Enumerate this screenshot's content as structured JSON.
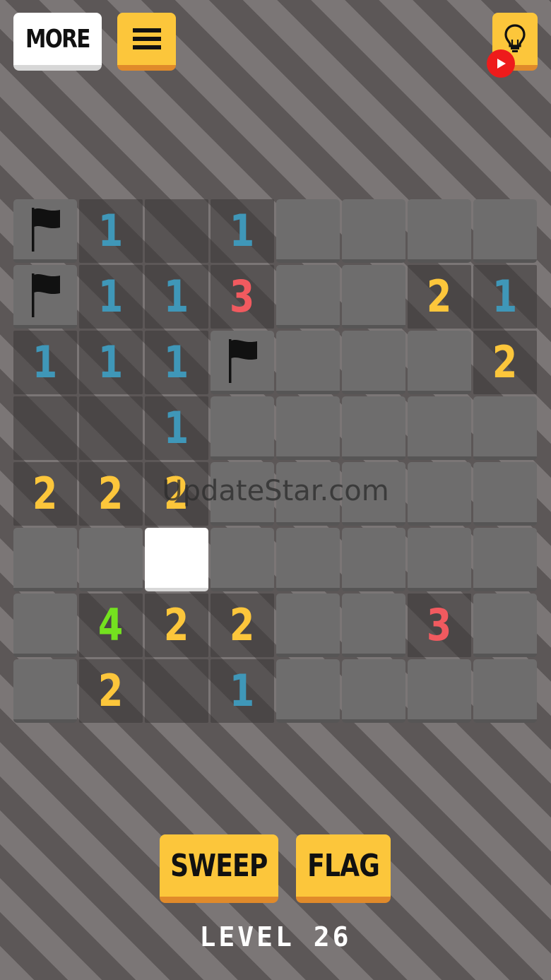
{
  "header": {
    "more_label": "MORE",
    "menu_icon": "hamburger-menu-icon",
    "hint_icon": "lightbulb-icon",
    "badge_icon": "video-play-icon"
  },
  "colors": {
    "accent_yellow": "#fcc63b",
    "accent_shadow": "#e08a2a",
    "num_blue": "#3f97b8",
    "num_yellow": "#fcc63b",
    "num_red": "#f15a5f",
    "num_green": "#74e21f"
  },
  "board": {
    "rows": [
      [
        "F",
        "1",
        "",
        "1",
        "H",
        "H",
        "H",
        "H"
      ],
      [
        "F",
        "1",
        "1",
        "3",
        "H",
        "H",
        "2",
        "1"
      ],
      [
        "1",
        "1",
        "1",
        "F",
        "H",
        "H",
        "H",
        "2"
      ],
      [
        "",
        "",
        "1",
        "H",
        "H",
        "H",
        "H",
        "H"
      ],
      [
        "2",
        "2",
        "2",
        "H",
        "H",
        "H",
        "H",
        "H"
      ],
      [
        "H",
        "H",
        "S",
        "H",
        "H",
        "H",
        "H",
        "H"
      ],
      [
        "H",
        "4",
        "2",
        "2",
        "H",
        "H",
        "3",
        "H"
      ],
      [
        "H",
        "2",
        "",
        "1",
        "H",
        "H",
        "H",
        "H"
      ]
    ],
    "legend": {
      "H": "hidden",
      "F": "flagged",
      "S": "selected"
    }
  },
  "watermark": "UpdateStar.com",
  "controls": {
    "sweep_label": "SWEEP",
    "flag_label": "FLAG"
  },
  "level_label": "LEVEL 26"
}
